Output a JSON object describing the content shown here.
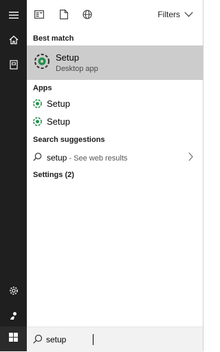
{
  "toolbar": {
    "filters_label": "Filters",
    "icons": [
      "apps-icon",
      "documents-icon",
      "web-icon"
    ]
  },
  "sidebar": {
    "icons": [
      "hamburger-menu-icon",
      "home-icon",
      "notebook-icon",
      "settings-gear-icon",
      "feedback-icon",
      "windows-start-icon"
    ]
  },
  "results": {
    "best_match_label": "Best match",
    "best_match": {
      "title": "Setup",
      "subtitle": "Desktop app"
    },
    "apps_label": "Apps",
    "apps": [
      {
        "label": "Setup"
      },
      {
        "label": "Setup"
      }
    ],
    "suggestions_label": "Search suggestions",
    "suggestion": {
      "query": "setup",
      "suffix": " - See web results"
    },
    "settings_label": "Settings (2)"
  },
  "search": {
    "value": "setup"
  },
  "colors": {
    "rail": "#1f1f1f",
    "highlight": "#cccccc",
    "app_icon_green": "#1f8f4a"
  }
}
